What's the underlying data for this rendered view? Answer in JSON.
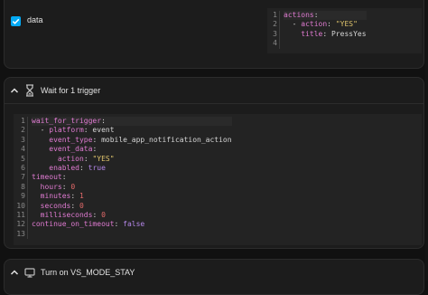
{
  "data_row": {
    "checked": true,
    "label": "data",
    "code_lines": [
      {
        "n": "1",
        "parts": [
          {
            "c": "k",
            "t": "actions"
          },
          {
            "c": "v",
            "t": ":"
          }
        ]
      },
      {
        "n": "2",
        "parts": [
          {
            "c": "v",
            "t": "  - "
          },
          {
            "c": "k",
            "t": "action"
          },
          {
            "c": "v",
            "t": ": "
          },
          {
            "c": "s",
            "t": "\"YES\""
          }
        ]
      },
      {
        "n": "3",
        "parts": [
          {
            "c": "v",
            "t": "    "
          },
          {
            "c": "k",
            "t": "title"
          },
          {
            "c": "v",
            "t": ": PressYes"
          }
        ]
      },
      {
        "n": "4",
        "parts": []
      }
    ]
  },
  "wait_section": {
    "title": "Wait for 1 trigger",
    "code_lines": [
      {
        "n": "1",
        "parts": [
          {
            "c": "k",
            "t": "wait_for_trigger"
          },
          {
            "c": "v",
            "t": ":"
          }
        ]
      },
      {
        "n": "2",
        "parts": [
          {
            "c": "v",
            "t": "  - "
          },
          {
            "c": "k",
            "t": "platform"
          },
          {
            "c": "v",
            "t": ": event"
          }
        ]
      },
      {
        "n": "3",
        "parts": [
          {
            "c": "v",
            "t": "    "
          },
          {
            "c": "k",
            "t": "event_type"
          },
          {
            "c": "v",
            "t": ": mobile_app_notification_action"
          }
        ]
      },
      {
        "n": "4",
        "parts": [
          {
            "c": "v",
            "t": "    "
          },
          {
            "c": "k",
            "t": "event_data"
          },
          {
            "c": "v",
            "t": ":"
          }
        ]
      },
      {
        "n": "5",
        "parts": [
          {
            "c": "v",
            "t": "      "
          },
          {
            "c": "k",
            "t": "action"
          },
          {
            "c": "v",
            "t": ": "
          },
          {
            "c": "s",
            "t": "\"YES\""
          }
        ]
      },
      {
        "n": "6",
        "parts": [
          {
            "c": "v",
            "t": "    "
          },
          {
            "c": "k",
            "t": "enabled"
          },
          {
            "c": "v",
            "t": ": "
          },
          {
            "c": "b",
            "t": "true"
          }
        ]
      },
      {
        "n": "7",
        "parts": [
          {
            "c": "k",
            "t": "timeout"
          },
          {
            "c": "v",
            "t": ":"
          }
        ]
      },
      {
        "n": "8",
        "parts": [
          {
            "c": "v",
            "t": "  "
          },
          {
            "c": "k",
            "t": "hours"
          },
          {
            "c": "v",
            "t": ": "
          },
          {
            "c": "n",
            "t": "0"
          }
        ]
      },
      {
        "n": "9",
        "parts": [
          {
            "c": "v",
            "t": "  "
          },
          {
            "c": "k",
            "t": "minutes"
          },
          {
            "c": "v",
            "t": ": "
          },
          {
            "c": "n",
            "t": "1"
          }
        ]
      },
      {
        "n": "10",
        "parts": [
          {
            "c": "v",
            "t": "  "
          },
          {
            "c": "k",
            "t": "seconds"
          },
          {
            "c": "v",
            "t": ": "
          },
          {
            "c": "n",
            "t": "0"
          }
        ]
      },
      {
        "n": "11",
        "parts": [
          {
            "c": "v",
            "t": "  "
          },
          {
            "c": "k",
            "t": "milliseconds"
          },
          {
            "c": "v",
            "t": ": "
          },
          {
            "c": "n",
            "t": "0"
          }
        ]
      },
      {
        "n": "12",
        "parts": [
          {
            "c": "k",
            "t": "continue_on_timeout"
          },
          {
            "c": "v",
            "t": ": "
          },
          {
            "c": "b",
            "t": "false"
          }
        ]
      },
      {
        "n": "13",
        "parts": []
      }
    ]
  },
  "turn_on_section": {
    "title": "Turn on VS_MODE_STAY"
  },
  "icons": {
    "checkbox": "checkbox-checked-icon",
    "collapse": "chevron-up-icon",
    "wait": "timer-sand-icon",
    "device": "device-icon"
  },
  "colors": {
    "accent": "#03a9f4",
    "key": "#e07bd2",
    "string": "#e0c46c",
    "number": "#e46a6a",
    "boolean": "#b487e8"
  }
}
